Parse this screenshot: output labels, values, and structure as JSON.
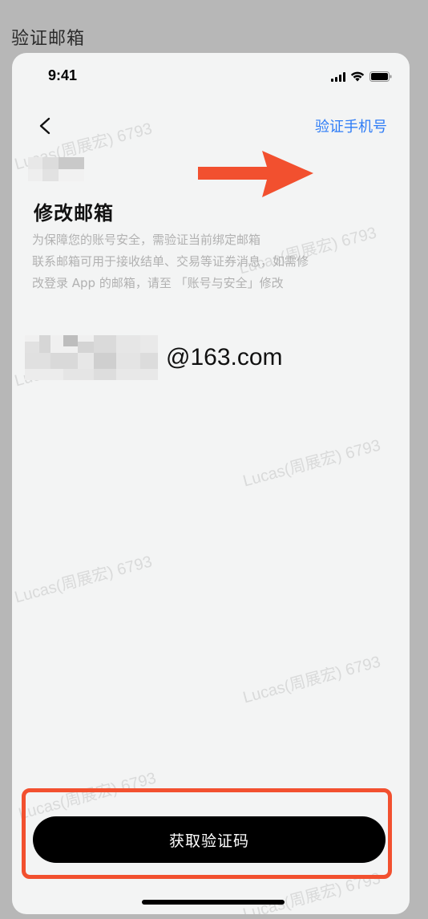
{
  "page_label": "验证邮箱",
  "status_bar": {
    "time": "9:41"
  },
  "nav": {
    "back_icon": "chevron-left-icon",
    "right_link": "验证手机号"
  },
  "content": {
    "title": "修改邮箱",
    "description_lines": [
      "为保障您的账号安全，需验证当前绑定邮箱",
      "联系邮箱可用于接收结单、交易等证券消息，如需修",
      "改登录 App 的邮箱，请至 「账号与安全」修改"
    ],
    "email_domain": "@163.com"
  },
  "watermark_text": "Lucas(周展宏) 6793",
  "action": {
    "primary_button": "获取验证码"
  },
  "colors": {
    "link": "#2e7cf6",
    "annotation": "#f2502f",
    "button_bg": "#000000"
  }
}
